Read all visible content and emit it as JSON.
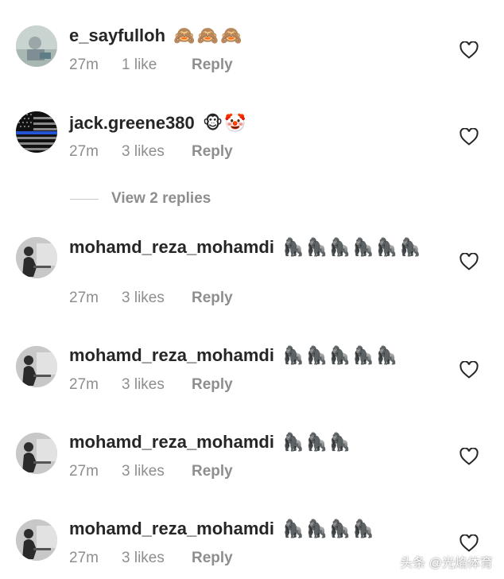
{
  "comments": [
    {
      "username": "e_sayfulloh",
      "emoji": "🙈🙈🙈",
      "time": "27m",
      "likes": "1 like",
      "reply": "Reply"
    },
    {
      "username": "jack.greene380",
      "emoji": "🐵🤡",
      "time": "27m",
      "likes": "3 likes",
      "reply": "Reply"
    },
    {
      "username": "mohamd_reza_mohamdi",
      "emoji": "🦍🦍🦍🦍🦍🦍",
      "time": "27m",
      "likes": "3 likes",
      "reply": "Reply"
    },
    {
      "username": "mohamd_reza_mohamdi",
      "emoji": "🦍🦍🦍🦍🦍",
      "time": "27m",
      "likes": "3 likes",
      "reply": "Reply"
    },
    {
      "username": "mohamd_reza_mohamdi",
      "emoji": "🦍🦍🦍",
      "time": "27m",
      "likes": "3 likes",
      "reply": "Reply"
    },
    {
      "username": "mohamd_reza_mohamdi",
      "emoji": "🦍🦍🦍🦍",
      "time": "27m",
      "likes": "3 likes",
      "reply": "Reply"
    }
  ],
  "view_replies": "View 2 replies",
  "watermark": "头条 @光焰体育",
  "colors": {
    "text": "#262626",
    "secondary": "#8e8e8e",
    "background": "#ffffff"
  },
  "icons": {
    "like": "heart-outline-icon"
  }
}
